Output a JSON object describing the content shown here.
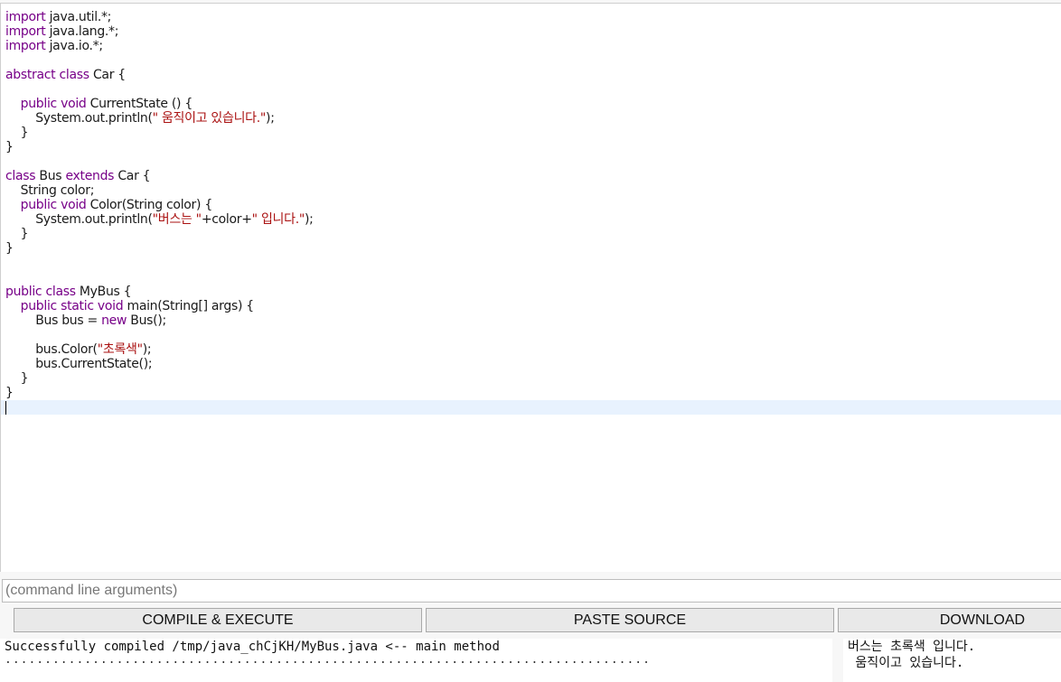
{
  "editor": {
    "lines": [
      [
        {
          "t": "import",
          "k": "kw"
        },
        {
          "t": " java.util.*;"
        }
      ],
      [
        {
          "t": "import",
          "k": "kw"
        },
        {
          "t": " java.lang.*;"
        }
      ],
      [
        {
          "t": "import",
          "k": "kw"
        },
        {
          "t": " java.io.*;"
        }
      ],
      [],
      [
        {
          "t": "abstract",
          "k": "kw"
        },
        {
          "t": " "
        },
        {
          "t": "class",
          "k": "kw"
        },
        {
          "t": " Car {"
        }
      ],
      [],
      [
        {
          "t": "    "
        },
        {
          "t": "public",
          "k": "kw"
        },
        {
          "t": " "
        },
        {
          "t": "void",
          "k": "kw"
        },
        {
          "t": " CurrentState () {"
        }
      ],
      [
        {
          "t": "        System.out.println("
        },
        {
          "t": "\" 움직이고 있습니다.\"",
          "k": "str"
        },
        {
          "t": ");"
        }
      ],
      [
        {
          "t": "    }"
        }
      ],
      [
        {
          "t": "}"
        }
      ],
      [],
      [
        {
          "t": "class",
          "k": "kw"
        },
        {
          "t": " Bus "
        },
        {
          "t": "extends",
          "k": "kw"
        },
        {
          "t": " Car {"
        }
      ],
      [
        {
          "t": "    String color;"
        }
      ],
      [
        {
          "t": "    "
        },
        {
          "t": "public",
          "k": "kw"
        },
        {
          "t": " "
        },
        {
          "t": "void",
          "k": "kw"
        },
        {
          "t": " Color(String color) {"
        }
      ],
      [
        {
          "t": "        System.out.println("
        },
        {
          "t": "\"버스는 \"",
          "k": "str"
        },
        {
          "t": "+color+"
        },
        {
          "t": "\" 입니다.\"",
          "k": "str"
        },
        {
          "t": ");"
        }
      ],
      [
        {
          "t": "    }"
        }
      ],
      [
        {
          "t": "}"
        }
      ],
      [],
      [],
      [
        {
          "t": "public",
          "k": "kw"
        },
        {
          "t": " "
        },
        {
          "t": "class",
          "k": "kw"
        },
        {
          "t": " MyBus {"
        }
      ],
      [
        {
          "t": "    "
        },
        {
          "t": "public",
          "k": "kw"
        },
        {
          "t": " "
        },
        {
          "t": "static",
          "k": "kw"
        },
        {
          "t": " "
        },
        {
          "t": "void",
          "k": "kw"
        },
        {
          "t": " main(String[] args) {"
        }
      ],
      [
        {
          "t": "        Bus bus = "
        },
        {
          "t": "new",
          "k": "kw"
        },
        {
          "t": " Bus();"
        }
      ],
      [],
      [
        {
          "t": "        bus.Color("
        },
        {
          "t": "\"초록색\"",
          "k": "str"
        },
        {
          "t": ");"
        }
      ],
      [
        {
          "t": "        bus.CurrentState();"
        }
      ],
      [
        {
          "t": "    }"
        }
      ],
      [
        {
          "t": "}"
        }
      ],
      []
    ],
    "active_line": 27
  },
  "args": {
    "placeholder": "(command line arguments)",
    "value": ""
  },
  "buttons": {
    "compile": "COMPILE & EXECUTE",
    "paste": "PASTE SOURCE",
    "download": "DOWNLOAD"
  },
  "compile_output": {
    "message": "Successfully compiled /tmp/java_chCjKH/MyBus.java <-- main method",
    "dots": "................................................................................."
  },
  "run_output": {
    "lines": [
      "버스는 초록색 입니다.",
      " 움직이고 있습니다."
    ]
  },
  "colors": {
    "keyword": "#770088",
    "string": "#aa1111",
    "active_line": "#e8f2fe"
  }
}
